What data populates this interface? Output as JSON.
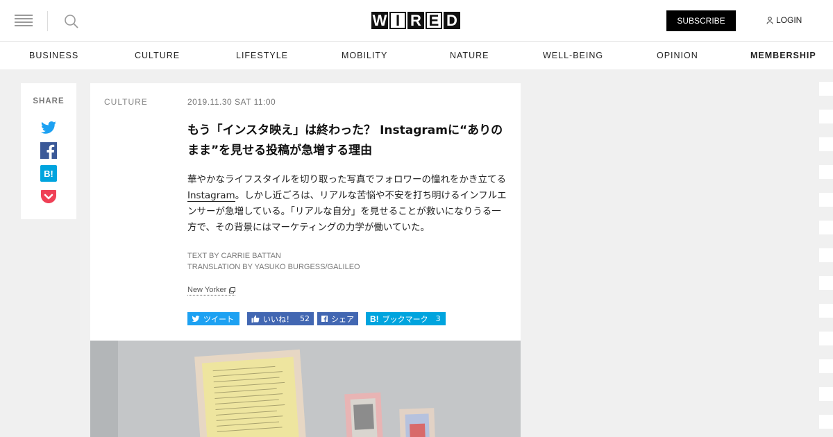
{
  "header": {
    "logo_letters": [
      "W",
      "I",
      "R",
      "E",
      "D"
    ],
    "subscribe_label": "SUBSCRIBE",
    "login_label": "LOGIN",
    "icons": [
      "hamburger-icon",
      "search-icon",
      "user-icon"
    ]
  },
  "nav": {
    "items": [
      {
        "label": "BUSINESS"
      },
      {
        "label": "CULTURE"
      },
      {
        "label": "LIFESTYLE"
      },
      {
        "label": "MOBILITY"
      },
      {
        "label": "NATURE"
      },
      {
        "label": "WELL-BEING"
      },
      {
        "label": "OPINION"
      },
      {
        "label": "MEMBERSHIP"
      }
    ]
  },
  "share_sidebar": {
    "label": "SHARE",
    "icons": [
      "twitter-icon",
      "facebook-icon",
      "hatena-bookmark-icon",
      "pocket-icon"
    ]
  },
  "article": {
    "category": "CULTURE",
    "date": "2019.11.30 SAT 11:00",
    "headline_line1": "もう「インスタ映え」は終わった？ Instagramに“ありの",
    "headline_line2": "まま”を見せる投稿が急増する理由",
    "lede_before": "華やかなライフスタイルを切り取った写真でフォロワーの憧れをかき立てる",
    "lede_link": "Instagram",
    "lede_after": "。しかし近ごろは、リアルな苦悩や不安を打ち明けるインフルエンサーが急増している。「リアルな自分」を見せることが救いになりうる一方で、その背景にはマーケティングの力学が働いていた。",
    "credit_text": "TEXT BY CARRIE BATTAN",
    "credit_translation": "TRANSLATION BY YASUKO BURGESS/GALILEO",
    "source": "New Yorker"
  },
  "social_buttons": {
    "tweet": {
      "label": "ツイート",
      "color": "#1da1f2"
    },
    "like": {
      "label": "いいね！",
      "count": "52",
      "color": "#4267b2"
    },
    "fb_share": {
      "label": "シェア",
      "color": "#4267b2"
    },
    "hatena": {
      "label": "ブックマーク",
      "count": "3",
      "color": "#00a4de"
    }
  },
  "colors": {
    "page_bg": "#f0f0f0",
    "twitter": "#1da1f2",
    "facebook": "#3b5998",
    "hatena": "#00a4de",
    "pocket": "#ef4056"
  }
}
